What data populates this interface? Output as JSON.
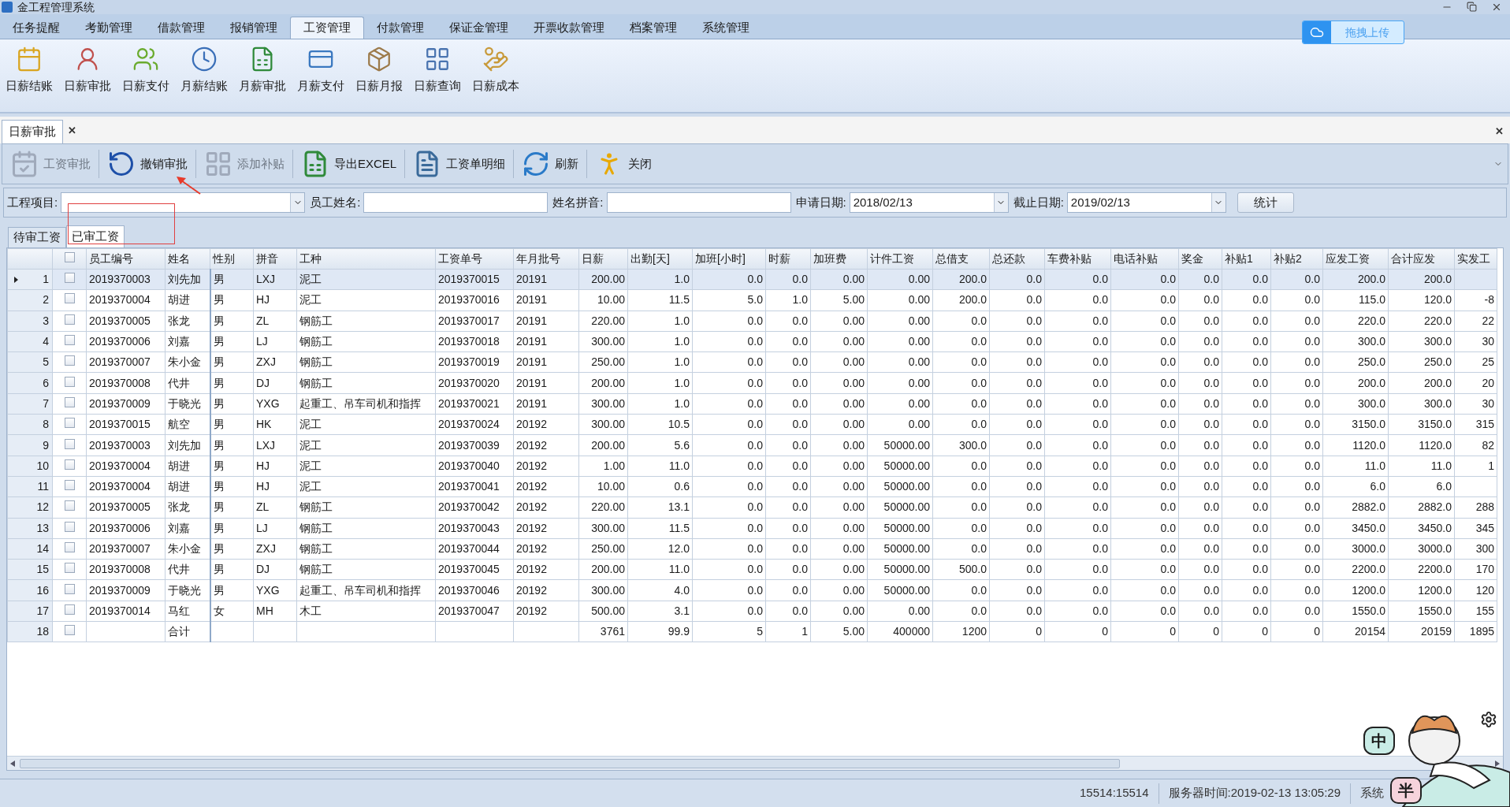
{
  "window": {
    "title": "金工程管理系统"
  },
  "menu_tabs": [
    {
      "label": "任务提醒",
      "selected": false
    },
    {
      "label": "考勤管理",
      "selected": false
    },
    {
      "label": "借款管理",
      "selected": false
    },
    {
      "label": "报销管理",
      "selected": false
    },
    {
      "label": "工资管理",
      "selected": true
    },
    {
      "label": "付款管理",
      "selected": false
    },
    {
      "label": "保证金管理",
      "selected": false
    },
    {
      "label": "开票收款管理",
      "selected": false
    },
    {
      "label": "档案管理",
      "selected": false
    },
    {
      "label": "系统管理",
      "selected": false
    }
  ],
  "upload_button": "拖拽上传",
  "ribbon": [
    {
      "label": "日薪结账",
      "kind": "calendar"
    },
    {
      "label": "日薪审批",
      "kind": "person"
    },
    {
      "label": "日薪支付",
      "kind": "people"
    },
    {
      "label": "月薪结账",
      "kind": "clock"
    },
    {
      "label": "月薪审批",
      "kind": "sheet"
    },
    {
      "label": "月薪支付",
      "kind": "card"
    },
    {
      "label": "日薪月报",
      "kind": "box"
    },
    {
      "label": "日薪查询",
      "kind": "grid"
    },
    {
      "label": "日薪成本",
      "kind": "hand"
    }
  ],
  "document_tab": {
    "label": "日薪审批",
    "close": "✕"
  },
  "panel_close": "✕",
  "toolbar": [
    {
      "label": "工资审批",
      "kind": "approve",
      "disabled": true
    },
    {
      "label": "撤销审批",
      "kind": "undo",
      "disabled": false
    },
    {
      "label": "添加补贴",
      "kind": "grid",
      "disabled": true
    },
    {
      "label": "导出EXCEL",
      "kind": "excel",
      "disabled": false
    },
    {
      "label": "工资单明细",
      "kind": "sheet",
      "disabled": false
    },
    {
      "label": "刷新",
      "kind": "refresh",
      "disabled": false
    },
    {
      "label": "关闭",
      "kind": "close",
      "disabled": false
    }
  ],
  "filters": [
    {
      "label": "工程项目:",
      "kind": "select"
    },
    {
      "label": "员工姓名:",
      "kind": "text"
    },
    {
      "label": "姓名拼音:",
      "kind": "text"
    },
    {
      "label": "申请日期:",
      "kind": "date",
      "value": "2018/02/13"
    },
    {
      "label": "截止日期:",
      "kind": "date",
      "value": "2019/02/13"
    }
  ],
  "stat_button": "统计",
  "sub_tabs": [
    {
      "label": "待审工资",
      "selected": false
    },
    {
      "label": "已审工资",
      "selected": true
    }
  ],
  "table": {
    "header_checked": false,
    "columns": [
      "员工编号",
      "姓名",
      "性别",
      "拼音",
      "工种",
      "工资单号",
      "年月批号",
      "日薪",
      "出勤[天]",
      "加班[小时]",
      "时薪",
      "加班费",
      "计件工资",
      "总借支",
      "总还款",
      "车费补贴",
      "电话补贴",
      "奖金",
      "补贴1",
      "补贴2",
      "应发工资",
      "合计应发",
      "实发工"
    ],
    "rows": [
      {
        "number": "1",
        "selected": true,
        "checked": false,
        "cells": [
          "2019370003",
          "刘先加",
          "男",
          "LXJ",
          "泥工",
          "2019370015",
          "20191",
          "200.00",
          "1.0",
          "0.0",
          "0.0",
          "0.00",
          "0.00",
          "200.0",
          "0.0",
          "0.0",
          "0.0",
          "0.0",
          "0.0",
          "0.0",
          "200.0",
          "200.0",
          null
        ]
      },
      {
        "number": "2",
        "selected": false,
        "checked": false,
        "cells": [
          "2019370004",
          "胡进",
          "男",
          "HJ",
          "泥工",
          "2019370016",
          "20191",
          "10.00",
          "11.5",
          "5.0",
          "1.0",
          "5.00",
          "0.00",
          "200.0",
          "0.0",
          "0.0",
          "0.0",
          "0.0",
          "0.0",
          "0.0",
          "115.0",
          "120.0",
          "-8"
        ]
      },
      {
        "number": "3",
        "selected": false,
        "checked": false,
        "cells": [
          "2019370005",
          "张龙",
          "男",
          "ZL",
          "钢筋工",
          "2019370017",
          "20191",
          "220.00",
          "1.0",
          "0.0",
          "0.0",
          "0.00",
          "0.00",
          "0.0",
          "0.0",
          "0.0",
          "0.0",
          "0.0",
          "0.0",
          "0.0",
          "220.0",
          "220.0",
          "22"
        ]
      },
      {
        "number": "4",
        "selected": false,
        "checked": false,
        "cells": [
          "2019370006",
          "刘嘉",
          "男",
          "LJ",
          "钢筋工",
          "2019370018",
          "20191",
          "300.00",
          "1.0",
          "0.0",
          "0.0",
          "0.00",
          "0.00",
          "0.0",
          "0.0",
          "0.0",
          "0.0",
          "0.0",
          "0.0",
          "0.0",
          "300.0",
          "300.0",
          "30"
        ]
      },
      {
        "number": "5",
        "selected": false,
        "checked": false,
        "cells": [
          "2019370007",
          "朱小金",
          "男",
          "ZXJ",
          "钢筋工",
          "2019370019",
          "20191",
          "250.00",
          "1.0",
          "0.0",
          "0.0",
          "0.00",
          "0.00",
          "0.0",
          "0.0",
          "0.0",
          "0.0",
          "0.0",
          "0.0",
          "0.0",
          "250.0",
          "250.0",
          "25"
        ]
      },
      {
        "number": "6",
        "selected": false,
        "checked": false,
        "cells": [
          "2019370008",
          "代井",
          "男",
          "DJ",
          "钢筋工",
          "2019370020",
          "20191",
          "200.00",
          "1.0",
          "0.0",
          "0.0",
          "0.00",
          "0.00",
          "0.0",
          "0.0",
          "0.0",
          "0.0",
          "0.0",
          "0.0",
          "0.0",
          "200.0",
          "200.0",
          "20"
        ]
      },
      {
        "number": "7",
        "selected": false,
        "checked": false,
        "cells": [
          "2019370009",
          "于晓光",
          "男",
          "YXG",
          "起重工、吊车司机和指挥",
          "2019370021",
          "20191",
          "300.00",
          "1.0",
          "0.0",
          "0.0",
          "0.00",
          "0.00",
          "0.0",
          "0.0",
          "0.0",
          "0.0",
          "0.0",
          "0.0",
          "0.0",
          "300.0",
          "300.0",
          "30"
        ]
      },
      {
        "number": "8",
        "selected": false,
        "checked": false,
        "cells": [
          "2019370015",
          "航空",
          "男",
          "HK",
          "泥工",
          "2019370024",
          "20192",
          "300.00",
          "10.5",
          "0.0",
          "0.0",
          "0.00",
          "0.00",
          "0.0",
          "0.0",
          "0.0",
          "0.0",
          "0.0",
          "0.0",
          "0.0",
          "3150.0",
          "3150.0",
          "315"
        ]
      },
      {
        "number": "9",
        "selected": false,
        "checked": false,
        "cells": [
          "2019370003",
          "刘先加",
          "男",
          "LXJ",
          "泥工",
          "2019370039",
          "20192",
          "200.00",
          "5.6",
          "0.0",
          "0.0",
          "0.00",
          "50000.00",
          "300.0",
          "0.0",
          "0.0",
          "0.0",
          "0.0",
          "0.0",
          "0.0",
          "1120.0",
          "1120.0",
          "82"
        ]
      },
      {
        "number": "10",
        "selected": false,
        "checked": false,
        "cells": [
          "2019370004",
          "胡进",
          "男",
          "HJ",
          "泥工",
          "2019370040",
          "20192",
          "1.00",
          "11.0",
          "0.0",
          "0.0",
          "0.00",
          "50000.00",
          "0.0",
          "0.0",
          "0.0",
          "0.0",
          "0.0",
          "0.0",
          "0.0",
          "11.0",
          "11.0",
          "1"
        ]
      },
      {
        "number": "11",
        "selected": false,
        "checked": false,
        "cells": [
          "2019370004",
          "胡进",
          "男",
          "HJ",
          "泥工",
          "2019370041",
          "20192",
          "10.00",
          "0.6",
          "0.0",
          "0.0",
          "0.00",
          "50000.00",
          "0.0",
          "0.0",
          "0.0",
          "0.0",
          "0.0",
          "0.0",
          "0.0",
          "6.0",
          "6.0",
          null
        ]
      },
      {
        "number": "12",
        "selected": false,
        "checked": false,
        "cells": [
          "2019370005",
          "张龙",
          "男",
          "ZL",
          "钢筋工",
          "2019370042",
          "20192",
          "220.00",
          "13.1",
          "0.0",
          "0.0",
          "0.00",
          "50000.00",
          "0.0",
          "0.0",
          "0.0",
          "0.0",
          "0.0",
          "0.0",
          "0.0",
          "2882.0",
          "2882.0",
          "288"
        ]
      },
      {
        "number": "13",
        "selected": false,
        "checked": false,
        "cells": [
          "2019370006",
          "刘嘉",
          "男",
          "LJ",
          "钢筋工",
          "2019370043",
          "20192",
          "300.00",
          "11.5",
          "0.0",
          "0.0",
          "0.00",
          "50000.00",
          "0.0",
          "0.0",
          "0.0",
          "0.0",
          "0.0",
          "0.0",
          "0.0",
          "3450.0",
          "3450.0",
          "345"
        ]
      },
      {
        "number": "14",
        "selected": false,
        "checked": false,
        "cells": [
          "2019370007",
          "朱小金",
          "男",
          "ZXJ",
          "钢筋工",
          "2019370044",
          "20192",
          "250.00",
          "12.0",
          "0.0",
          "0.0",
          "0.00",
          "50000.00",
          "0.0",
          "0.0",
          "0.0",
          "0.0",
          "0.0",
          "0.0",
          "0.0",
          "3000.0",
          "3000.0",
          "300"
        ]
      },
      {
        "number": "15",
        "selected": false,
        "checked": false,
        "cells": [
          "2019370008",
          "代井",
          "男",
          "DJ",
          "钢筋工",
          "2019370045",
          "20192",
          "200.00",
          "11.0",
          "0.0",
          "0.0",
          "0.00",
          "50000.00",
          "500.0",
          "0.0",
          "0.0",
          "0.0",
          "0.0",
          "0.0",
          "0.0",
          "2200.0",
          "2200.0",
          "170"
        ]
      },
      {
        "number": "16",
        "selected": false,
        "checked": false,
        "cells": [
          "2019370009",
          "于晓光",
          "男",
          "YXG",
          "起重工、吊车司机和指挥",
          "2019370046",
          "20192",
          "300.00",
          "4.0",
          "0.0",
          "0.0",
          "0.00",
          "50000.00",
          "0.0",
          "0.0",
          "0.0",
          "0.0",
          "0.0",
          "0.0",
          "0.0",
          "1200.0",
          "1200.0",
          "120"
        ]
      },
      {
        "number": "17",
        "selected": false,
        "checked": false,
        "cells": [
          "2019370014",
          "马红",
          "女",
          "MH",
          "木工",
          "2019370047",
          "20192",
          "500.00",
          "3.1",
          "0.0",
          "0.0",
          "0.00",
          "0.00",
          "0.0",
          "0.0",
          "0.0",
          "0.0",
          "0.0",
          "0.0",
          "0.0",
          "1550.0",
          "1550.0",
          "155"
        ]
      },
      {
        "number": "18",
        "selected": false,
        "checked": false,
        "cells": [
          null,
          "合计",
          null,
          null,
          null,
          null,
          null,
          "3761",
          "99.9",
          "5",
          "1",
          "5.00",
          "400000",
          "1200",
          "0",
          "0",
          "0",
          "0",
          "0",
          "0",
          "20154",
          "20159",
          "1895"
        ]
      }
    ]
  },
  "status_bar": [
    "15514:15514",
    "服务器时间:2019-02-13 13:05:29",
    "系统"
  ],
  "ime": {
    "mode": "中",
    "width": "半"
  }
}
